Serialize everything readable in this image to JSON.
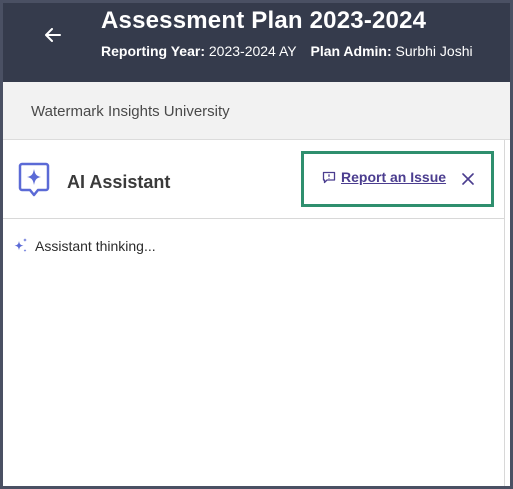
{
  "header": {
    "title": "Assessment Plan 2023-2024",
    "reporting_year_label": "Reporting Year:",
    "reporting_year_value": "2023-2024 AY",
    "plan_admin_label": "Plan Admin:",
    "plan_admin_value": "Surbhi Joshi"
  },
  "org": {
    "name": "Watermark Insights University"
  },
  "assistant": {
    "title": "AI Assistant",
    "report_label": "Report an Issue",
    "status": "Assistant thinking..."
  },
  "colors": {
    "header_bg": "#353b4c",
    "link": "#4b3d8f",
    "highlight": "#2f8f6e",
    "ai_icon": "#5b6ad6"
  },
  "icons": {
    "back": "arrow-left-icon",
    "ai_logo": "ai-sparkle-chat-icon",
    "report": "message-alert-icon",
    "close": "close-icon",
    "thinking": "sparkle-icon"
  }
}
